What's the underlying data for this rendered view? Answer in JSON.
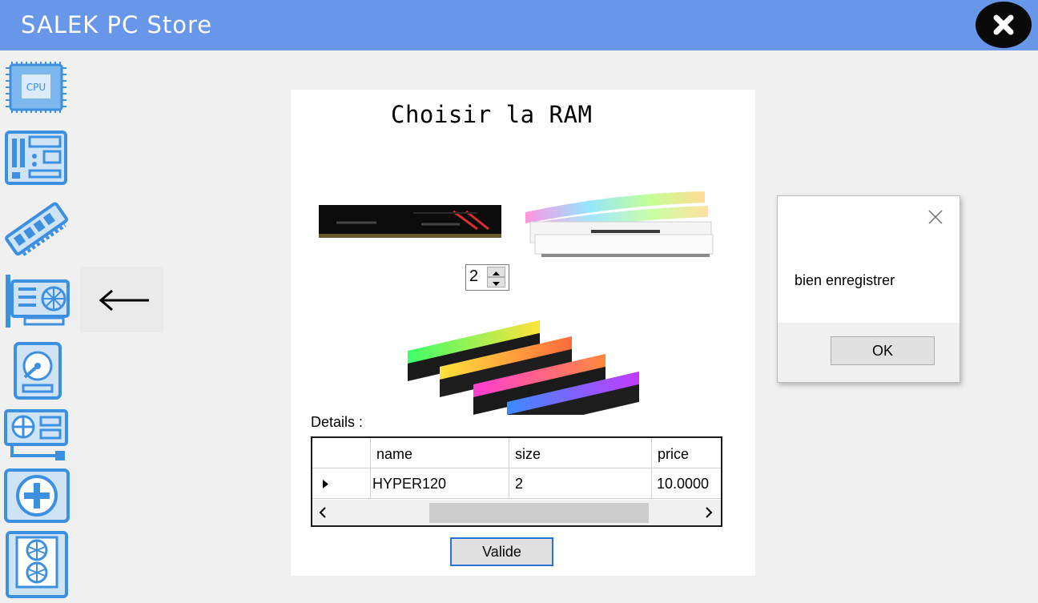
{
  "app": {
    "title": "SALEK PC Store"
  },
  "main": {
    "heading": "Choisir la RAM"
  },
  "quantity": {
    "value": "2"
  },
  "details": {
    "label": "Details :",
    "columns": [
      "name",
      "size",
      "price"
    ],
    "rows": [
      {
        "name": "HYPER120",
        "size": "2",
        "price": "10.0000"
      }
    ]
  },
  "buttons": {
    "valide": "Valide"
  },
  "dialog": {
    "message": "bien enregistrer",
    "ok": "OK"
  },
  "icons": {
    "sidebar": [
      "cpu-icon",
      "motherboard-icon",
      "ram-icon",
      "graphics-card-icon",
      "hard-drive-icon",
      "power-supply-icon",
      "case-fan-icon",
      "cooler-icon"
    ],
    "back": "arrow-left-icon",
    "close": "close-icon"
  },
  "colors": {
    "titlebar": "#6896e8",
    "icon_blue": "#3d8fe0",
    "icon_fill": "#cfe3f7",
    "focus_border": "#2a72d5"
  }
}
